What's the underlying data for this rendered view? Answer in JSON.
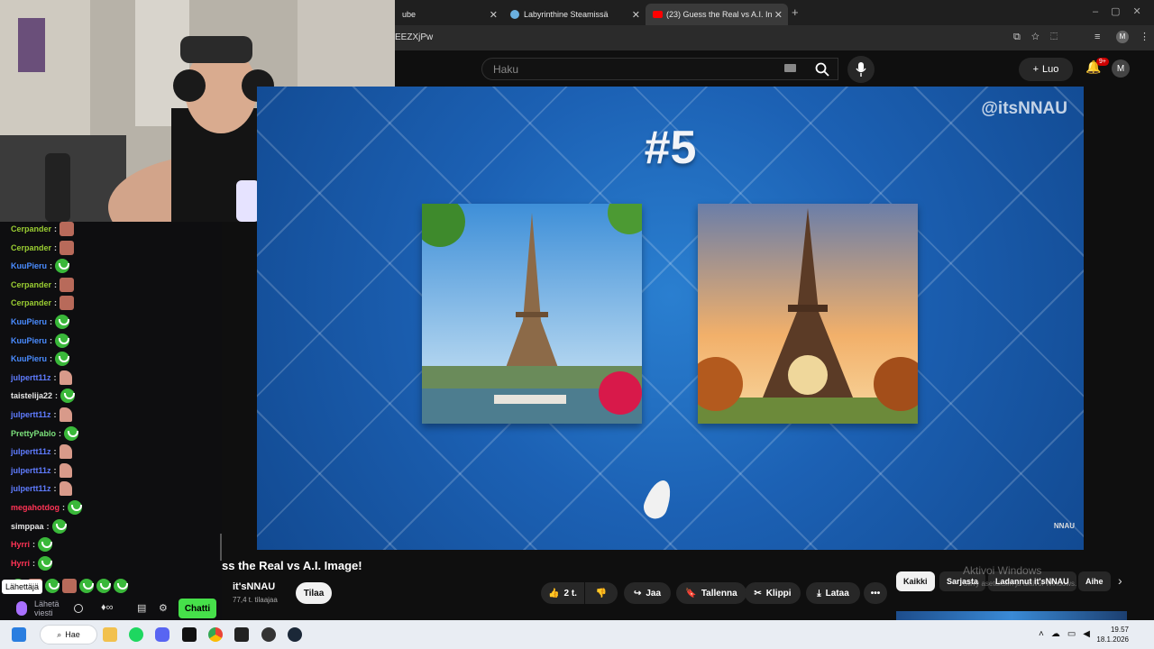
{
  "browser": {
    "tabs": [
      {
        "label": "ube",
        "close": "✕"
      },
      {
        "label": "Labyrinthine Steamissä",
        "close": "✕"
      },
      {
        "label": "(23) Guess the Real vs A.I. In",
        "close": "✕"
      }
    ],
    "new_tab": "+",
    "url": "EEZXjPw"
  },
  "youtube": {
    "search_placeholder": "Haku",
    "create_label": "Luo",
    "notification_count": "9+",
    "avatar_letter": "M"
  },
  "video": {
    "watermark": "@itsNNAU",
    "number": "#5",
    "corner_logo": "NNAU"
  },
  "below": {
    "title": "ss the Real vs A.I. Image!",
    "channel": "it'sNNAU",
    "subscribers": "77,4 t. tilaajaa",
    "subscribe": "Tilaa",
    "likes": "2 t.",
    "share": "Jaa",
    "save": "Tallenna",
    "clip": "Klippi",
    "download": "Lataa",
    "more": "•••",
    "chips": [
      "Kaikki",
      "Sarjasta",
      "Ladannut it'sNNAU",
      "Aihe"
    ],
    "activate_title": "Aktivoi Windows",
    "activate_sub": "Siirry asetuksiin ja aktivoi Windows."
  },
  "chat": {
    "messages": [
      {
        "user": "Cerpander",
        "color": "#9acd32",
        "emote": "face"
      },
      {
        "user": "Cerpander",
        "color": "#9acd32",
        "emote": "face"
      },
      {
        "user": "KuuPieru",
        "color": "#4a8cff",
        "emote": "frog"
      },
      {
        "user": "Cerpander",
        "color": "#9acd32",
        "emote": "face"
      },
      {
        "user": "Cerpander",
        "color": "#9acd32",
        "emote": "face"
      },
      {
        "user": "KuuPieru",
        "color": "#4a8cff",
        "emote": "frog"
      },
      {
        "user": "KuuPieru",
        "color": "#4a8cff",
        "emote": "frog"
      },
      {
        "user": "KuuPieru",
        "color": "#4a8cff",
        "emote": "frog"
      },
      {
        "user": "julpertt11z",
        "color": "#5f7cff",
        "emote": "hand"
      },
      {
        "user": "taistelija22",
        "color": "#e8e8e8",
        "emote": "frog"
      },
      {
        "user": "julpertt11z",
        "color": "#5f7cff",
        "emote": "hand"
      },
      {
        "user": "PrettyPablo",
        "color": "#7be07b",
        "emote": "frog"
      },
      {
        "user": "julpertt11z",
        "color": "#5f7cff",
        "emote": "hand"
      },
      {
        "user": "julpertt11z",
        "color": "#5f7cff",
        "emote": "hand"
      },
      {
        "user": "julpertt11z",
        "color": "#5f7cff",
        "emote": "hand"
      },
      {
        "user": "megahotdog",
        "color": "#ff3355",
        "emote": "frog"
      },
      {
        "user": "simppaa",
        "color": "#e8e8e8",
        "emote": "frog"
      },
      {
        "user": "Hyrri",
        "color": "#ff3355",
        "emote": "frog"
      },
      {
        "user": "Hyrri",
        "color": "#ff3355",
        "emote": "frog"
      }
    ],
    "tooltip": "Lähettäjä",
    "send_placeholder_1": "Lähetä",
    "send_placeholder_2": "viesti",
    "chat_button": "Chatti"
  },
  "taskbar": {
    "search_label": "Hae",
    "time": "19.57",
    "date": "18.1.2026"
  }
}
